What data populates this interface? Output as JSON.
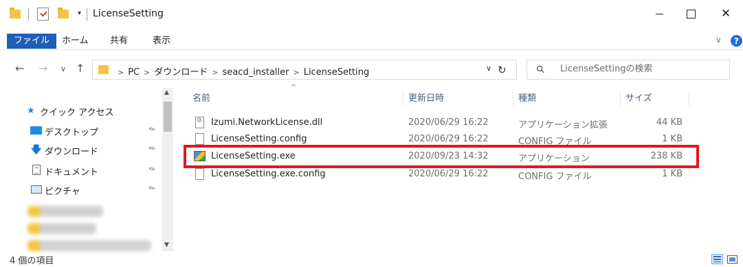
{
  "window": {
    "title": "LicenseSetting",
    "minimize_glyph": "",
    "maximize_glyph": "",
    "close_glyph": "✕"
  },
  "ribbon": {
    "tabs": [
      "ファイル",
      "ホーム",
      "共有",
      "表示"
    ],
    "collapse_glyph": "∨",
    "help_glyph": "?"
  },
  "address": {
    "crumbs": [
      "PC",
      "ダウンロード",
      "seacd_installer",
      "LicenseSetting"
    ],
    "back_glyph": "←",
    "forward_glyph": "→",
    "recent_glyph": "∨",
    "up_glyph": "↑",
    "dropdown_glyph": "∨",
    "refresh_glyph": "↻"
  },
  "search": {
    "placeholder": "LicenseSettingの検索"
  },
  "navpane": {
    "quick_access": "クイック アクセス",
    "items": [
      {
        "label": "デスクトップ",
        "icon": "desktop-icon"
      },
      {
        "label": "ダウンロード",
        "icon": "download-icon"
      },
      {
        "label": "ドキュメント",
        "icon": "document-icon"
      },
      {
        "label": "ピクチャ",
        "icon": "pictures-icon"
      }
    ],
    "pin_glyph": "📌",
    "star_glyph": "★"
  },
  "filelist": {
    "columns": {
      "name": "名前",
      "date": "更新日時",
      "type": "種類",
      "size": "サイズ"
    },
    "sort_glyph": "^",
    "rows": [
      {
        "name": "Izumi.NetworkLicense.dll",
        "date": "2020/06/29 16:22",
        "type": "アプリケーション拡張",
        "size": "44 KB",
        "icon": "dll-file-icon"
      },
      {
        "name": "LicenseSetting.config",
        "date": "2020/06/29 16:22",
        "type": "CONFIG ファイル",
        "size": "1 KB",
        "icon": "config-file-icon"
      },
      {
        "name": "LicenseSetting.exe",
        "date": "2020/09/23 14:32",
        "type": "アプリケーション",
        "size": "238 KB",
        "icon": "exe-file-icon",
        "highlighted": true
      },
      {
        "name": "LicenseSetting.exe.config",
        "date": "2020/06/29 16:22",
        "type": "CONFIG ファイル",
        "size": "1 KB",
        "icon": "config-file-icon"
      }
    ]
  },
  "status": {
    "item_count": "4 個の項目"
  },
  "colors": {
    "accent": "#1f5fb5",
    "highlight_box": "#e8141c",
    "folder": "#f3c544"
  }
}
